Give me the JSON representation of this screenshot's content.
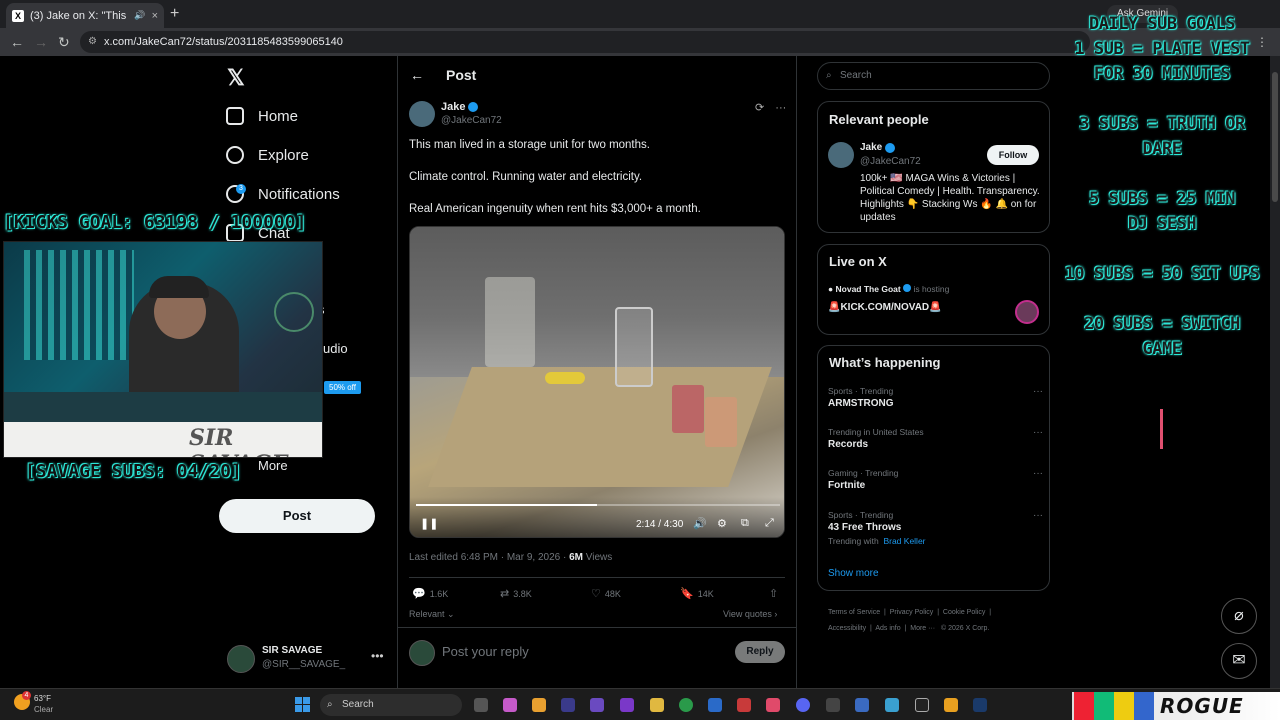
{
  "browser": {
    "tab_title": "(3) Jake on X: \"This man live",
    "tab_favicon": "X",
    "close_icon": "×",
    "new_tab": "+",
    "gemini_label": "Ask Gemini",
    "url": "x.com/JakeCan72/status/2031185483599065140"
  },
  "nav": {
    "logo": "𝕏",
    "items": [
      {
        "label": "Home",
        "icon": "home-icon"
      },
      {
        "label": "Explore",
        "icon": "search-icon"
      },
      {
        "label": "Notifications",
        "icon": "bell-icon"
      },
      {
        "label": "Chat",
        "icon": "mail-icon"
      }
    ],
    "notif_count": "3",
    "partial_labels": [
      "s",
      "udio",
      "More"
    ],
    "promo_badge": "50% off",
    "post_button": "Post",
    "account": {
      "name": "SIR SAVAGE",
      "handle": "@SIR__SAVAGE_"
    }
  },
  "post": {
    "header_title": "Post",
    "author_name": "Jake",
    "author_handle": "@JakeCan72",
    "lines": [
      "This man lived in a storage unit for two months.",
      "Climate control. Running water and electricity.",
      "Real American ingenuity when rent hits $3,000+ a month."
    ],
    "video": {
      "time": "2:14 / 4:30",
      "progress": 0.497
    },
    "meta_prefix": "Last edited 6:48 PM · Mar 9, 2026 · ",
    "views_count": "6M",
    "views_label": " Views",
    "stats": {
      "replies": "1.6K",
      "reposts": "3.8K",
      "likes": "48K",
      "bookmarks": "14K"
    },
    "relevant_label": "Relevant",
    "view_quotes": "View quotes",
    "reply_placeholder": "Post your reply",
    "reply_button": "Reply"
  },
  "sidebar": {
    "search_placeholder": "Search",
    "relevant_title": "Relevant people",
    "relevant_person": {
      "name": "Jake",
      "handle": "@JakeCan72",
      "follow": "Follow",
      "bio": "100k+ 🇺🇸 MAGA Wins & Victories | Political Comedy | Health. Transparency. Highlights 👇 Stacking Ws 🔥 🔔 on for updates"
    },
    "live_title": "Live on X",
    "live_host": "Novad The Goat",
    "live_hosting": "is hosting",
    "live_stream": "🚨KICK.COM/NOVAD🚨",
    "happening_title": "What’s happening",
    "trends": [
      {
        "category": "Sports · Trending",
        "title": "ARMSTRONG"
      },
      {
        "category": "Trending in United States",
        "title": "Records"
      },
      {
        "category": "Gaming · Trending",
        "title": "Fortnite"
      },
      {
        "category": "Sports · Trending",
        "title": "43 Free Throws",
        "with_label": "Trending with",
        "with_name": "Brad Keller"
      }
    ],
    "show_more": "Show more",
    "footer": [
      "Terms of Service",
      "Privacy Policy",
      "Cookie Policy",
      "Accessibility",
      "Ads info",
      "More ···",
      "© 2026 X Corp."
    ]
  },
  "overlay": {
    "goals_title": "DAILY SUB GOALS",
    "goals": [
      "1 SUB = PLATE VEST\nFOR 30 MINUTES",
      "3 SUBS = TRUTH OR\nDARE",
      "5 SUBS = 25 MIN\nDJ SESH",
      "10 SUBS = 50 SIT UPS",
      "20 SUBS = SWITCH\nGAME"
    ],
    "kicks_goal": "[KICKS GOAL: 63198 / 100000]",
    "savage_subs": "[SAVAGE SUBS: 04/20]",
    "webcam_signature": "SIR SAVAGE"
  },
  "taskbar": {
    "temp": "63°F",
    "condition": "Clear",
    "weather_badge": "4",
    "search": "Search",
    "brand": "ROGUE"
  },
  "colors": {
    "accent": "#1d9bf0",
    "overlay_glow": "#2ee6d6",
    "background": "#000000"
  }
}
